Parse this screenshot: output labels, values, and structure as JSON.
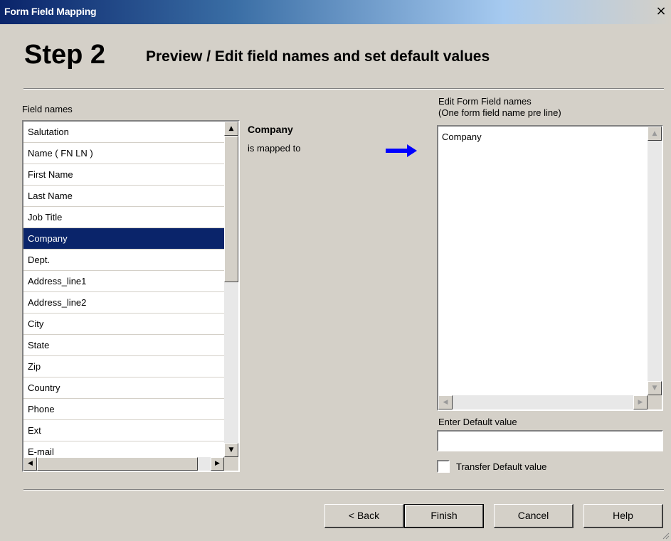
{
  "window": {
    "title": "Form Field Mapping",
    "close_glyph": "×"
  },
  "header": {
    "step": "Step 2",
    "description": "Preview / Edit field names and set default values"
  },
  "field_list": {
    "label": "Field names",
    "items": [
      "Salutation",
      "Name ( FN LN )",
      "First Name",
      "Last Name",
      "Job Title",
      "Company",
      "Dept.",
      "Address_line1",
      "Address_line2",
      "City",
      "State",
      "Zip",
      "Country",
      "Phone",
      "Ext",
      "E-mail"
    ],
    "selected_index": 5,
    "selected_color": "#0a246a",
    "scroll_up_glyph": "▲",
    "scroll_down_glyph": "▼",
    "scroll_left_glyph": "◀",
    "scroll_right_glyph": "▶"
  },
  "mapping": {
    "field": "Company",
    "mapped_to_label": "is mapped to",
    "arrow_icon": "right-arrow-icon",
    "arrow_color": "#0000ff"
  },
  "editor": {
    "label_line1": "Edit Form Field names",
    "label_line2": "(One form field name pre line)",
    "value": "Company",
    "scroll_up_glyph": "▲",
    "scroll_down_glyph": "▼",
    "scroll_left_glyph": "◀",
    "scroll_right_glyph": "▶"
  },
  "default_value": {
    "label": "Enter Default value",
    "value": ""
  },
  "transfer": {
    "label": "Transfer Default value",
    "checked": false
  },
  "buttons": {
    "back": "< Back",
    "finish": "Finish",
    "cancel": "Cancel",
    "help": "Help"
  }
}
